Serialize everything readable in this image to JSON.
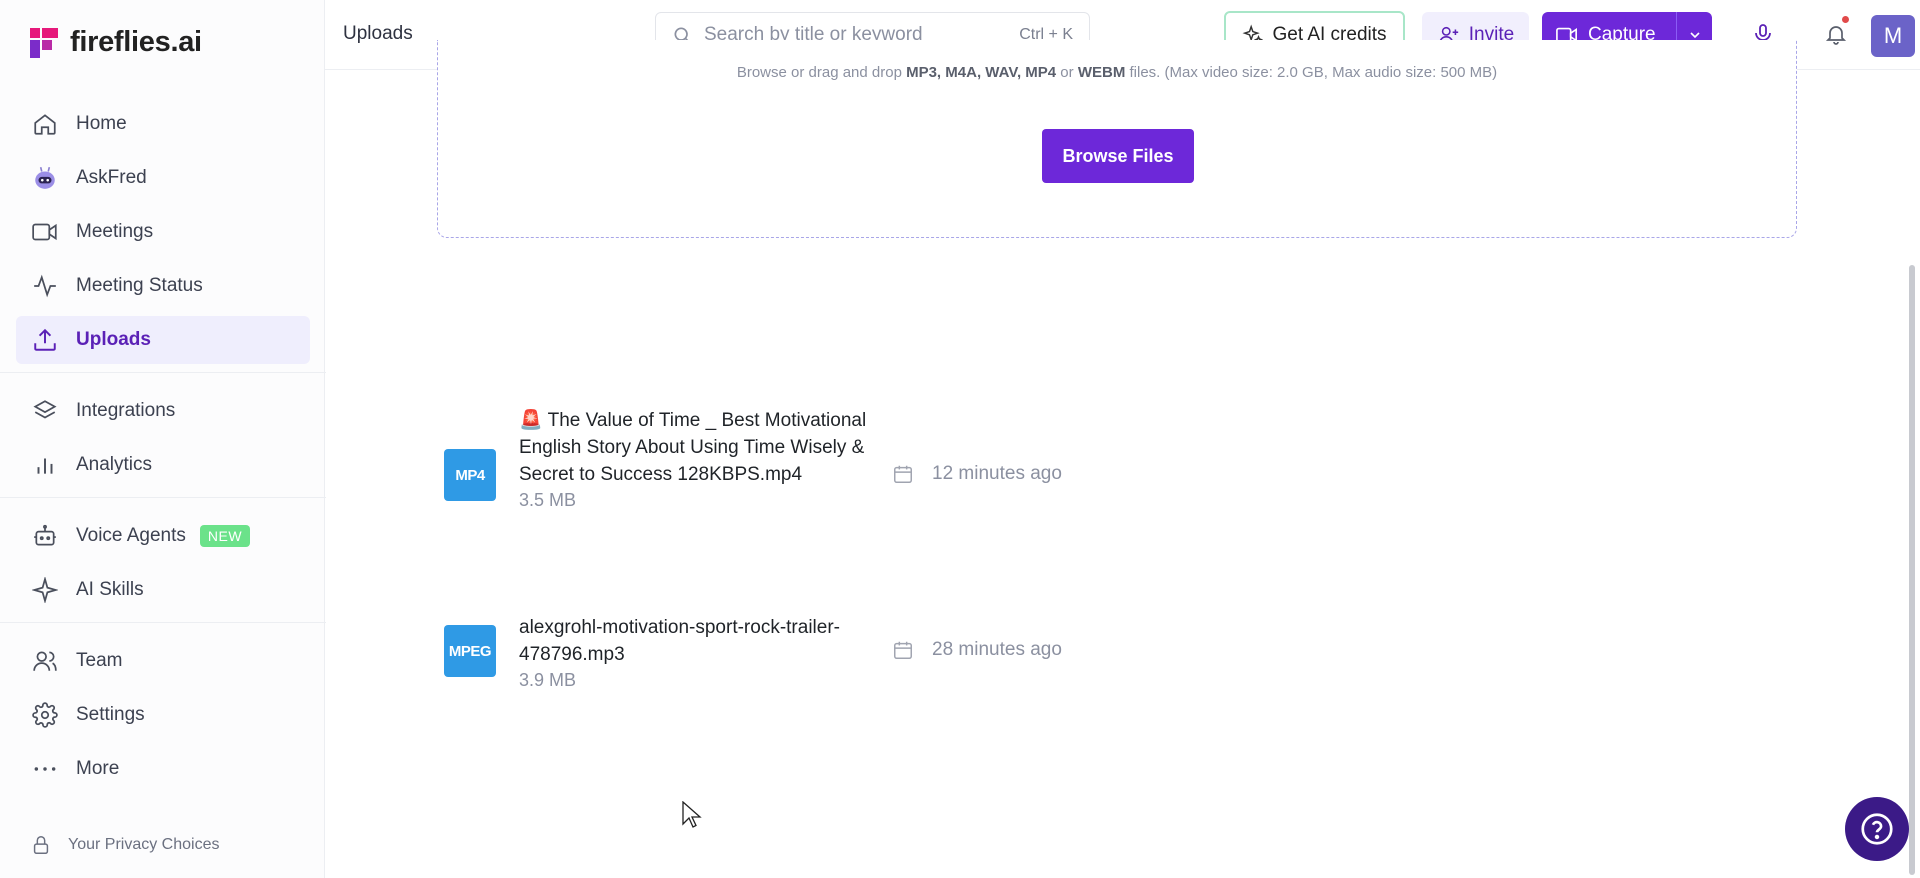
{
  "brand": {
    "name": "fireflies.ai"
  },
  "sidebar": {
    "items": [
      {
        "label": "Home",
        "icon": "home-icon"
      },
      {
        "label": "AskFred",
        "icon": "robot-icon"
      },
      {
        "label": "Meetings",
        "icon": "video-icon"
      },
      {
        "label": "Meeting Status",
        "icon": "activity-icon"
      },
      {
        "label": "Uploads",
        "icon": "upload-icon",
        "active": true
      },
      {
        "label": "Integrations",
        "icon": "layers-icon"
      },
      {
        "label": "Analytics",
        "icon": "bar-chart-icon"
      },
      {
        "label": "Voice Agents",
        "icon": "bot-icon",
        "badge": "NEW"
      },
      {
        "label": "AI Skills",
        "icon": "sparkle-icon"
      },
      {
        "label": "Team",
        "icon": "users-icon"
      },
      {
        "label": "Settings",
        "icon": "gear-icon"
      },
      {
        "label": "More",
        "icon": "more-icon"
      }
    ],
    "privacy": "Your Privacy Choices"
  },
  "header": {
    "title": "Uploads",
    "search_placeholder": "Search by title or keyword",
    "search_shortcut": "Ctrl + K",
    "credits_label": "Get AI credits",
    "invite_label": "Invite",
    "capture_label": "Capture",
    "avatar_initial": "M"
  },
  "dropzone": {
    "hint_prefix": "Browse or drag and drop ",
    "hint_formats": "MP3, M4A, WAV, MP4",
    "hint_or": " or ",
    "hint_webm": "WEBM",
    "hint_suffix": " files. (Max video size: 2.0 GB, Max audio size: 500 MB)",
    "browse_label": "Browse Files"
  },
  "files": [
    {
      "type": "MP4",
      "name": "🚨 The Value of Time _ Best Motivational English Story About Using Time Wisely & Secret to Success 128KBPS.mp4",
      "size": "3.5 MB",
      "time": "12 minutes ago"
    },
    {
      "type": "MPEG",
      "name": "alexgrohl-motivation-sport-rock-trailer-478796.mp3",
      "size": "3.9 MB",
      "time": "28 minutes ago"
    }
  ],
  "colors": {
    "accent": "#6d28d9",
    "file_badge": "#2f9ae5",
    "new_badge": "#6be28a",
    "help_button": "#3b1a87"
  }
}
